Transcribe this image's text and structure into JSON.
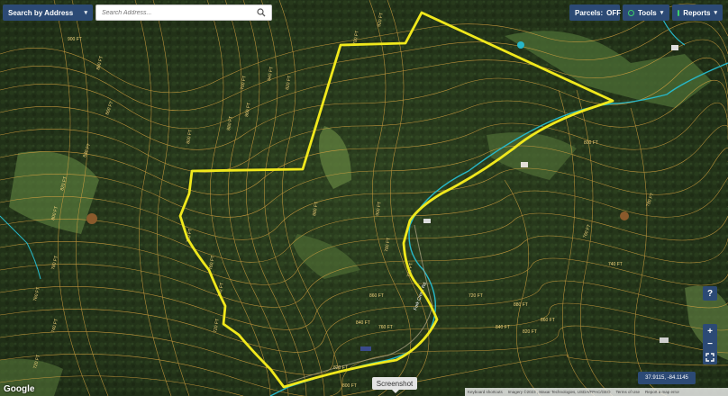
{
  "header": {
    "search_by_label": "Search by Address",
    "search_placeholder": "Search Address...",
    "parcels_label": "Parcels:",
    "parcels_state": "OFF",
    "tools_label": "Tools",
    "reports_label": "Reports"
  },
  "map": {
    "contour_labels": [
      "900 FT",
      "880 FT",
      "860 FT",
      "840 FT",
      "820 FT",
      "800 FT",
      "780 FT",
      "760 FT",
      "740 FT",
      "720 FT",
      "700 FT",
      "880 FT",
      "860 FT",
      "840 FT",
      "820 FT",
      "800 FT",
      "780 FT",
      "760 FT",
      "740 FT",
      "720 FT",
      "700 FT",
      "920 FT",
      "900 FT",
      "880 FT",
      "860 FT",
      "840 FT",
      "820 FT",
      "800 FT",
      "780 FT",
      "760 FT",
      "740 FT",
      "720 FT",
      "880 FT",
      "860 FT",
      "840 FT",
      "820 FT",
      "800 FT",
      "780 FT",
      "760 FT",
      "740 FT"
    ],
    "road_label": "Fork Creek Rd",
    "colors": {
      "boundary": "#f0e81c",
      "contour": "#d9a441",
      "creek": "#27b8c9",
      "forest_dark": "#1d2d14",
      "forest_mid": "#2f4522"
    }
  },
  "controls": {
    "help": "?",
    "zoom_in": "+",
    "zoom_out": "−",
    "fullscreen_icon": "fullscreen-icon"
  },
  "coordinates": "37.9115, -84.1145",
  "screenshot_label": "Screenshot",
  "google_logo": "Google",
  "attribution": {
    "shortcuts": "Keyboard shortcuts",
    "imagery": "Imagery ©2023 , Maxar Technologies, USDA/FPAC/GEO",
    "terms": "Terms of Use",
    "report": "Report a map error"
  }
}
